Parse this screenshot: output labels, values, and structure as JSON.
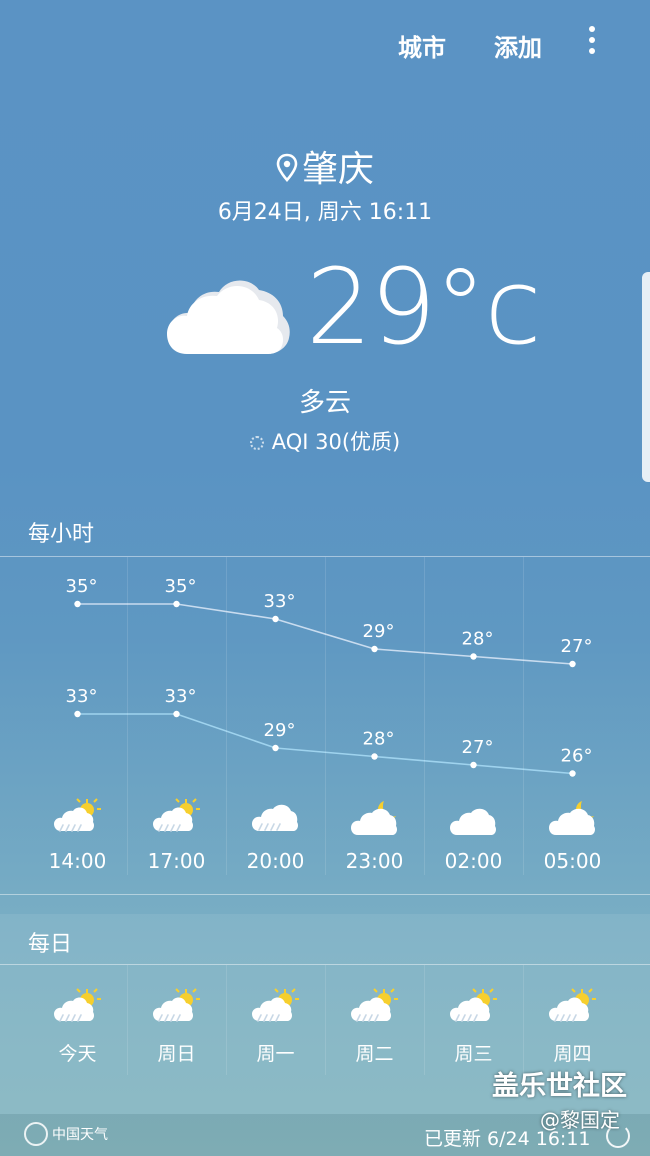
{
  "topbar": {
    "city_label": "城市",
    "add_label": "添加",
    "more_icon": "more-vert-icon"
  },
  "location": {
    "city": "肇庆",
    "pin_icon": "location-pin-icon",
    "datetime": "6月24日, 周六 16:11"
  },
  "current": {
    "icon": "cloud-icon",
    "temperature": "29°c",
    "condition": "多云",
    "aqi": "AQI 30(优质)"
  },
  "hourly": {
    "title": "每小时",
    "items": [
      {
        "time": "14:00",
        "high": 35,
        "low": 33,
        "high_label": "35°",
        "low_label": "33°",
        "icon": "partly-sunny-rain-icon"
      },
      {
        "time": "17:00",
        "high": 35,
        "low": 33,
        "high_label": "35°",
        "low_label": "33°",
        "icon": "partly-sunny-rain-icon"
      },
      {
        "time": "20:00",
        "high": 33,
        "low": 29,
        "high_label": "33°",
        "low_label": "29°",
        "icon": "cloud-rain-icon"
      },
      {
        "time": "23:00",
        "high": 29,
        "low": 28,
        "high_label": "29°",
        "low_label": "28°",
        "icon": "cloudy-night-icon"
      },
      {
        "time": "02:00",
        "high": 28,
        "low": 27,
        "high_label": "28°",
        "low_label": "27°",
        "icon": "cloud-icon"
      },
      {
        "time": "05:00",
        "high": 27,
        "low": 26,
        "high_label": "27°",
        "low_label": "26°",
        "icon": "cloudy-night-icon"
      }
    ]
  },
  "daily": {
    "title": "每日",
    "items": [
      {
        "day": "今天",
        "icon": "partly-sunny-rain-icon"
      },
      {
        "day": "周日",
        "icon": "partly-sunny-rain-icon"
      },
      {
        "day": "周一",
        "icon": "partly-sunny-rain-icon"
      },
      {
        "day": "周二",
        "icon": "partly-sunny-rain-icon"
      },
      {
        "day": "周三",
        "icon": "partly-sunny-rain-icon"
      },
      {
        "day": "周四",
        "icon": "partly-sunny-rain-icon"
      }
    ]
  },
  "footer": {
    "provider": "中国天气",
    "updated": "已更新 6/24  16:11"
  },
  "watermark": {
    "line1": "盖乐世社区",
    "line2": "@黎国定"
  },
  "colors": {
    "high_line": "#c9dcef",
    "low_line": "#9fd3ee",
    "sun": "#f6cf2e"
  }
}
